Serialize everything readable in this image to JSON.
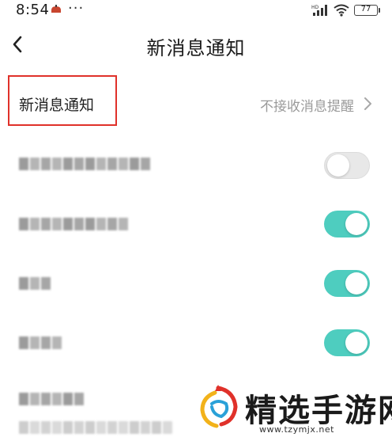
{
  "status_bar": {
    "time": "8:54",
    "dots": "···",
    "battery": "77",
    "network_label": "HD"
  },
  "header": {
    "title": "新消息通知",
    "back_icon": "chevron-left-icon"
  },
  "main_setting": {
    "label": "新消息通知",
    "value": "不接收消息提醒",
    "highlight_color": "#e0312a"
  },
  "settings": [
    {
      "toggle": "off"
    },
    {
      "toggle": "on"
    },
    {
      "toggle": "on"
    },
    {
      "toggle": "on"
    }
  ],
  "colors": {
    "toggle_on": "#4ecdbf",
    "toggle_off": "#e8e8e8"
  },
  "watermark": {
    "text": "精选手游网",
    "url": "www.tzymjx.net"
  }
}
